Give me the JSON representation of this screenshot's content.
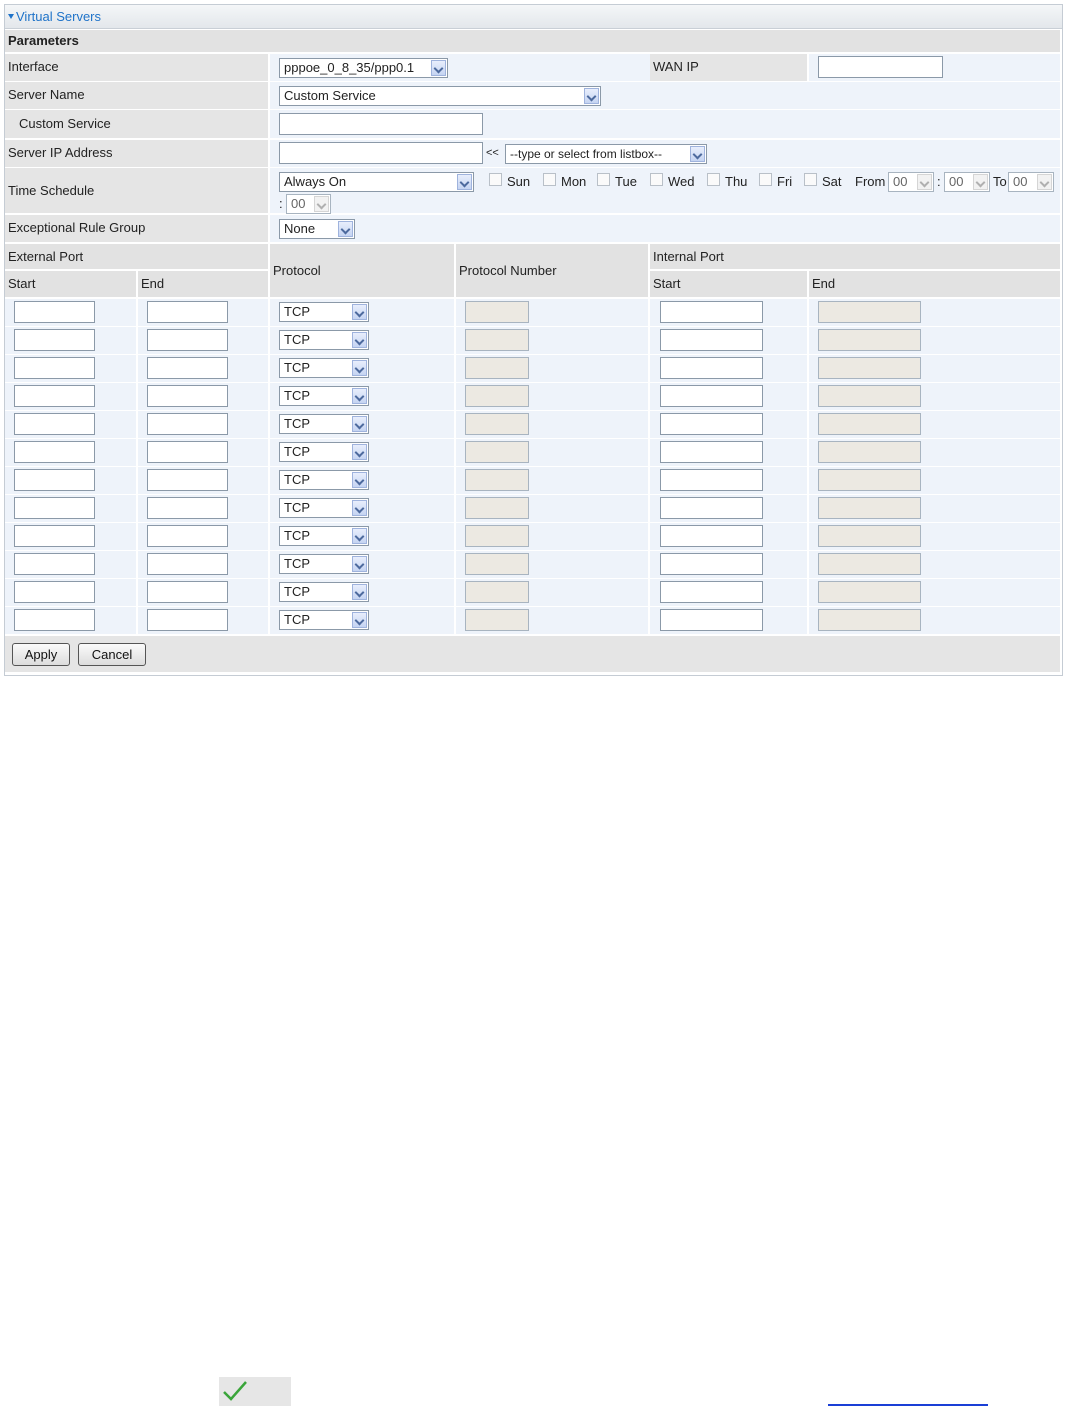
{
  "panel": {
    "title": "Virtual Servers"
  },
  "params": {
    "section_label": "Parameters",
    "interface": {
      "label": "Interface",
      "value": "pppoe_0_8_35/ppp0.1"
    },
    "wan_ip": {
      "label": "WAN IP",
      "value": ""
    },
    "server_name": {
      "label": "Server Name",
      "value": "Custom Service"
    },
    "custom_service": {
      "label": "Custom Service",
      "value": ""
    },
    "server_ip": {
      "label": "Server IP Address",
      "value": "",
      "arrow": "<<",
      "listbox": "--type or select from listbox--"
    },
    "schedule": {
      "label": "Time Schedule",
      "value": "Always On",
      "days": [
        "Sun",
        "Mon",
        "Tue",
        "Wed",
        "Thu",
        "Fri",
        "Sat"
      ],
      "from_label": "From",
      "to_label": "To",
      "colon": ":",
      "from_hour": "00",
      "from_min": "00",
      "to_hour": "00",
      "to_min": "00"
    },
    "exceptional": {
      "label": "Exceptional Rule Group",
      "value": "None"
    }
  },
  "ports": {
    "external_port": "External Port",
    "start": "Start",
    "end": "End",
    "protocol": "Protocol",
    "protocol_number": "Protocol Number",
    "internal_port": "Internal Port",
    "rows": [
      {
        "protocol": "TCP"
      },
      {
        "protocol": "TCP"
      },
      {
        "protocol": "TCP"
      },
      {
        "protocol": "TCP"
      },
      {
        "protocol": "TCP"
      },
      {
        "protocol": "TCP"
      },
      {
        "protocol": "TCP"
      },
      {
        "protocol": "TCP"
      },
      {
        "protocol": "TCP"
      },
      {
        "protocol": "TCP"
      },
      {
        "protocol": "TCP"
      },
      {
        "protocol": "TCP"
      }
    ]
  },
  "buttons": {
    "apply": "Apply",
    "cancel": "Cancel"
  },
  "icons": {
    "check": "check-icon",
    "dropdown": "chevron-down-icon"
  },
  "colors": {
    "accent": "#1f73c9",
    "check": "#3aa53a",
    "link": "#1a3fd6"
  }
}
